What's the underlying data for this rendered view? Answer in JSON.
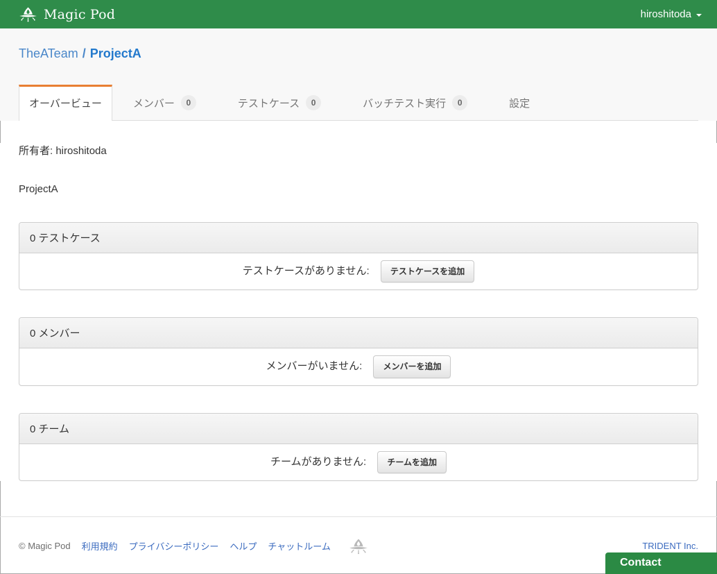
{
  "navbar": {
    "brand": "Magic Pod",
    "user": "hiroshitoda"
  },
  "breadcrumb": {
    "organization": "TheATeam",
    "separator": "/",
    "project": "ProjectA"
  },
  "tabs": [
    {
      "label": "オーバービュー"
    },
    {
      "label": "メンバー",
      "badge": "0"
    },
    {
      "label": "テストケース",
      "badge": "0"
    },
    {
      "label": "バッチテスト実行",
      "badge": "0"
    },
    {
      "label": "設定"
    }
  ],
  "overview": {
    "owner_line": "所有者: hiroshitoda",
    "project_name": "ProjectA"
  },
  "panels": [
    {
      "title": "0 テストケース",
      "empty_message": "テストケースがありません:",
      "button_label": "テストケースを追加"
    },
    {
      "title": "0 メンバー",
      "empty_message": "メンバーがいません:",
      "button_label": "メンバーを追加"
    },
    {
      "title": "0 チーム",
      "empty_message": "チームがありません:",
      "button_label": "チームを追加"
    }
  ],
  "footer": {
    "copyright": "© Magic Pod",
    "links": [
      "利用規約",
      "プライバシーポリシー",
      "ヘルプ",
      "チャットルーム"
    ],
    "company_link": "TRIDENT Inc.",
    "contact_label": "Contact"
  },
  "colors": {
    "navbar_green": "#2f8c4a",
    "tab_accent_orange": "#e87f33",
    "link_blue": "#3b6bbf",
    "contact_green": "#2b8a44",
    "badge_bg": "#ececec"
  }
}
